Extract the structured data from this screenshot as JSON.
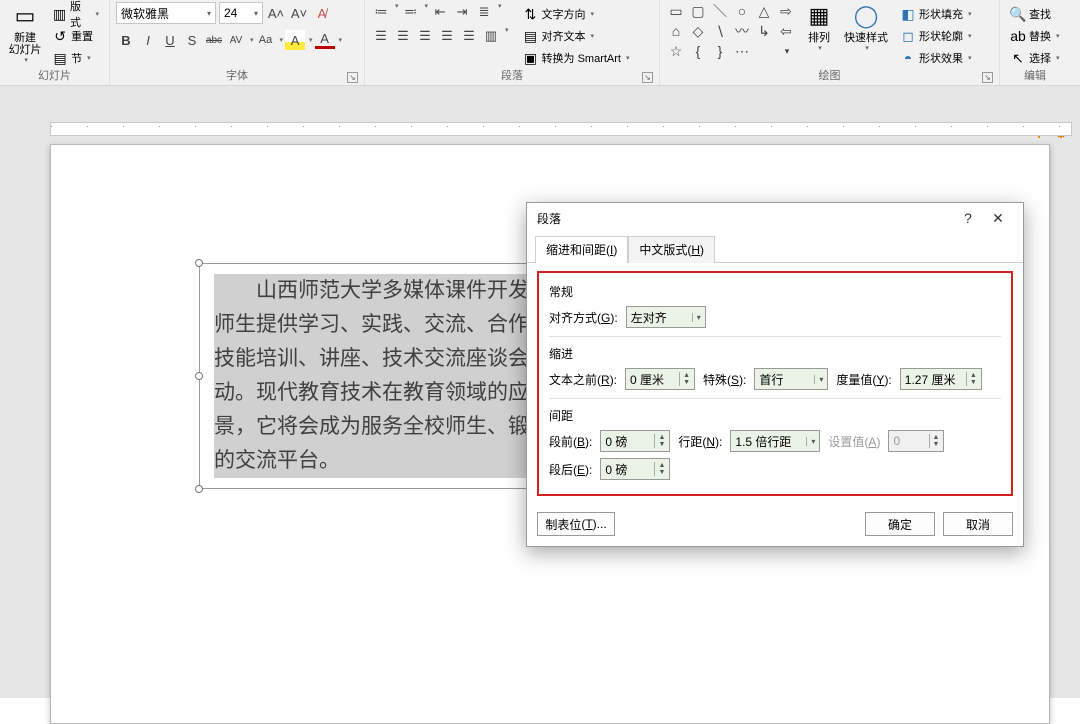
{
  "ribbon": {
    "slide": {
      "new_slide": "新建\n幻灯片",
      "layout": "版式",
      "reset": "重置",
      "section": "节",
      "group": "幻灯片"
    },
    "font": {
      "name": "微软雅黑",
      "size": "24",
      "group": "字体",
      "bold": "B",
      "italic": "I",
      "underline": "U",
      "shadow": "S",
      "strike": "abc",
      "char_spacing": "AV",
      "case": "Aa"
    },
    "paragraph": {
      "group": "段落",
      "text_direction": "文字方向",
      "align_text": "对齐文本",
      "smartart": "转换为 SmartArt"
    },
    "drawing": {
      "group": "绘图",
      "arrange": "排列",
      "quick_styles": "快速样式",
      "shape_fill": "形状填充",
      "shape_outline": "形状轮廓",
      "shape_effects": "形状效果"
    },
    "editing": {
      "group": "编辑",
      "find": "查找",
      "replace": "替换",
      "select": "选择"
    }
  },
  "slide_text": "山西师范大学多媒体课件开发中心与数学与信息协会合并，是一个为师生提供学习、实践、交流、合作、比赛平台的从教技术协会，目前已有技能培训、讲座、技术交流座谈会、课件制作大赛、平面设计大赛等活动。现代教育技术在教育领域的应用正展现出巨量的潜力和远大的发展前景，它将会成为服务全校师生、锻炼学生综合能力的最具活力与创新意识的交流平台。",
  "dialog": {
    "title": "段落",
    "tab_indent": "缩进和间距",
    "tab_indent_key": "I",
    "tab_asian": "中文版式",
    "tab_asian_key": "H",
    "general": "常规",
    "alignment_label": "对齐方式",
    "alignment_key": "G",
    "alignment_value": "左对齐",
    "indent": "缩进",
    "before_text_label": "文本之前",
    "before_text_key": "R",
    "before_text_value": "0 厘米",
    "special_label": "特殊",
    "special_key": "S",
    "special_value": "首行",
    "by_label": "度量值",
    "by_key": "Y",
    "by_value": "1.27 厘米",
    "spacing": "间距",
    "before_label": "段前",
    "before_key": "B",
    "before_value": "0 磅",
    "line_label": "行距",
    "line_key": "N",
    "line_value": "1.5 倍行距",
    "at_label": "设置值",
    "at_key": "A",
    "at_value": "0",
    "after_label": "段后",
    "after_key": "E",
    "after_value": "0 磅",
    "tabs_btn": "制表位",
    "tabs_key": "T",
    "ok": "确定",
    "cancel": "取消"
  }
}
